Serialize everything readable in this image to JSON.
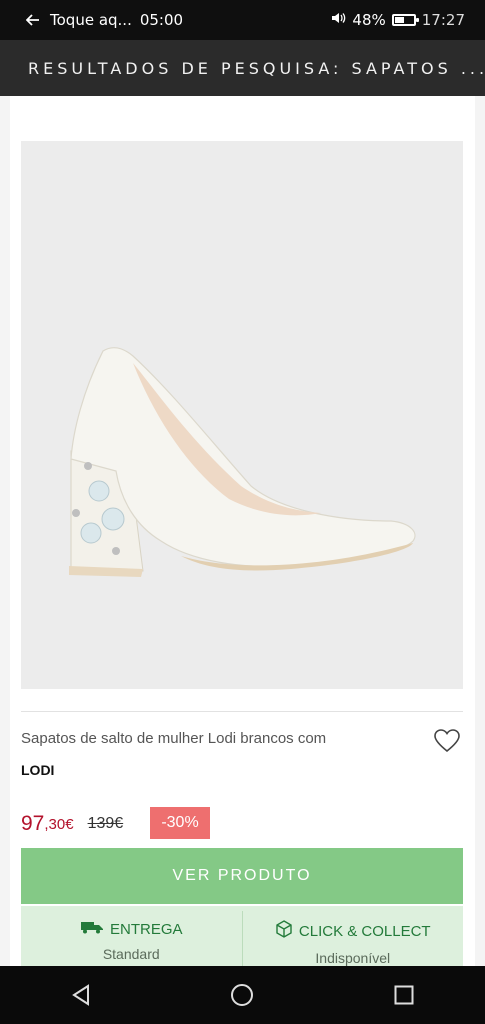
{
  "status_bar": {
    "notification": "Toque aq...",
    "alarm": "05:00",
    "battery": "48%",
    "battery_level": 0.48,
    "time": "17:27"
  },
  "header": {
    "title": "RESULTADOS DE PESQUISA: SAPATOS ..."
  },
  "product": {
    "name": "Sapatos de salto de mulher Lodi brancos com",
    "brand": "LODI",
    "price_integer": "97",
    "price_cents": ",30€",
    "price_old": "139€",
    "discount": "-30%",
    "view_button": "VER PRODUTO",
    "image_icon": "white-pump-shoe"
  },
  "delivery": {
    "shipping_label": "ENTREGA",
    "shipping_value": "Standard",
    "collect_label": "CLICK & COLLECT",
    "collect_value": "Indisponível"
  },
  "colors": {
    "header_bg": "#2b2b2b",
    "price": "#b3122c",
    "discount_bg": "#ee6f6f",
    "button_bg": "#84c986",
    "delivery_bg": "#ddf0dd",
    "delivery_text": "#237a3a"
  }
}
